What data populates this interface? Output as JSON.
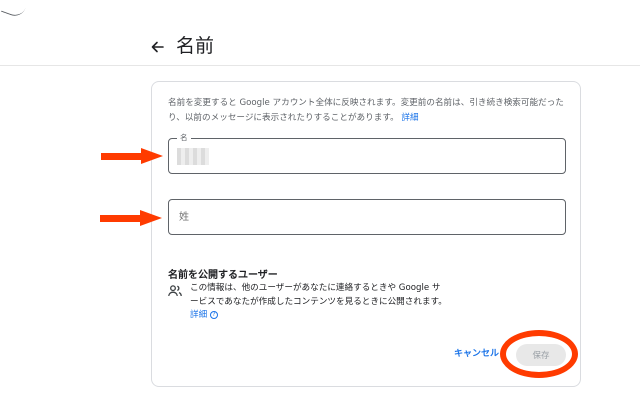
{
  "header": {
    "title": "名前"
  },
  "card": {
    "description": "名前を変更すると Google アカウント全体に反映されます。変更前の名前は、引き続き検索可能だったり、以前のメッセージに表示されたりすることがあります。",
    "description_link": "詳細",
    "first_name": {
      "label": "名",
      "value": ""
    },
    "last_name": {
      "placeholder": "姓",
      "value": ""
    },
    "section_title": "名前を公開するユーザー",
    "info_text": "この情報は、他のユーザーがあなたに連絡するときや Google サービスであなたが作成したコンテンツを見るときに公開されます。",
    "info_link": "詳細",
    "cancel_label": "キャンセル",
    "save_label": "保存"
  },
  "colors": {
    "accent": "#1a73e8",
    "annotation": "#ff3b00"
  },
  "icons": {
    "back": "arrow-left-icon",
    "people": "people-icon",
    "help": "help-circle-icon"
  }
}
